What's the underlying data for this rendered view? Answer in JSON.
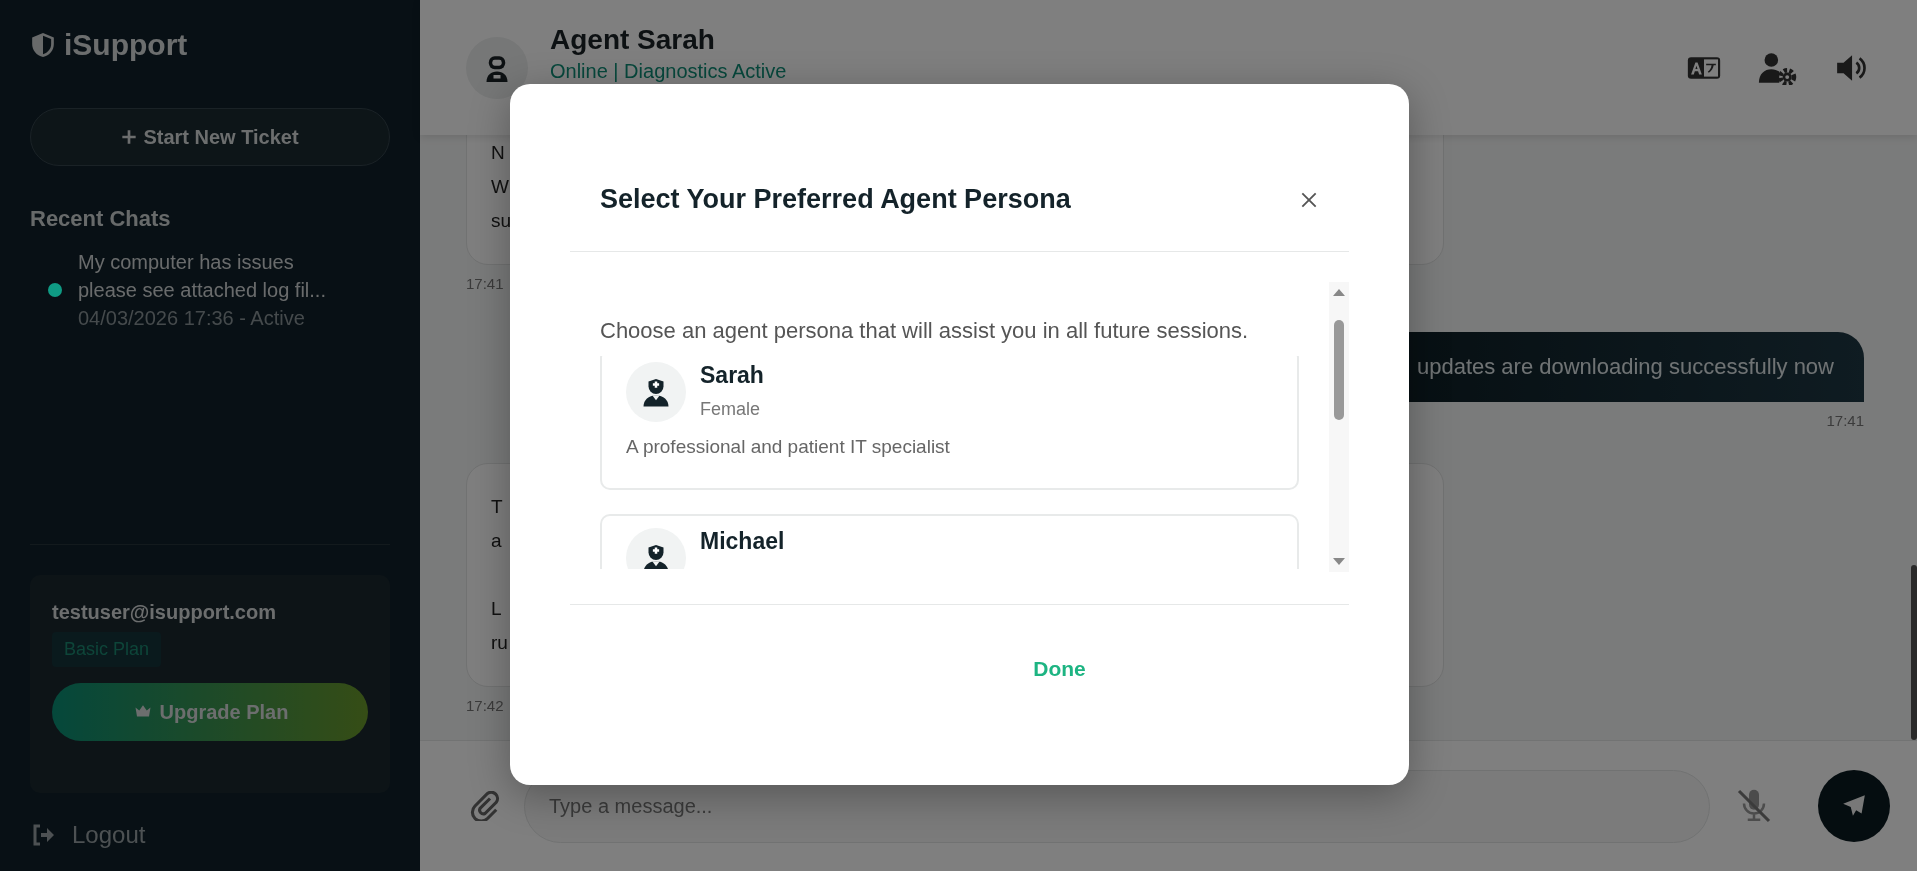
{
  "sidebar": {
    "logo": "iSupport",
    "new_ticket": "Start New Ticket",
    "section_title": "Recent Chats",
    "chats": [
      {
        "title": "My computer has issues please see attached log fil...",
        "meta": "04/03/2026 17:36 - Active",
        "color": "#0f9b84"
      }
    ],
    "account": {
      "email": "testuser@isupport.com",
      "plan": "Basic Plan",
      "upgrade": "Upgrade Plan"
    },
    "logout": "Logout"
  },
  "header": {
    "agent_name": "Agent Sarah",
    "status": "Online | Diagnostics Active"
  },
  "messages": [
    {
      "kind": "agent",
      "paragraphs": [
        [
          "N",
          "W",
          "su"
        ]
      ],
      "time": "17:41"
    },
    {
      "kind": "user",
      "text": "updates are downloading successfully now",
      "time": "17:41"
    },
    {
      "kind": "agent",
      "paragraphs": [
        [
          "T",
          "a"
        ],
        [
          "L",
          "ru"
        ]
      ],
      "time": "17:42"
    }
  ],
  "composer": {
    "placeholder": "Type a message..."
  },
  "modal": {
    "title": "Select Your Preferred Agent Persona",
    "description": "Choose an agent persona that will assist you in all future sessions.",
    "personas": [
      {
        "name": "Sarah",
        "gender": "Female",
        "summary": "A professional and patient IT specialist"
      },
      {
        "name": "Michael"
      }
    ],
    "done": "Done"
  }
}
